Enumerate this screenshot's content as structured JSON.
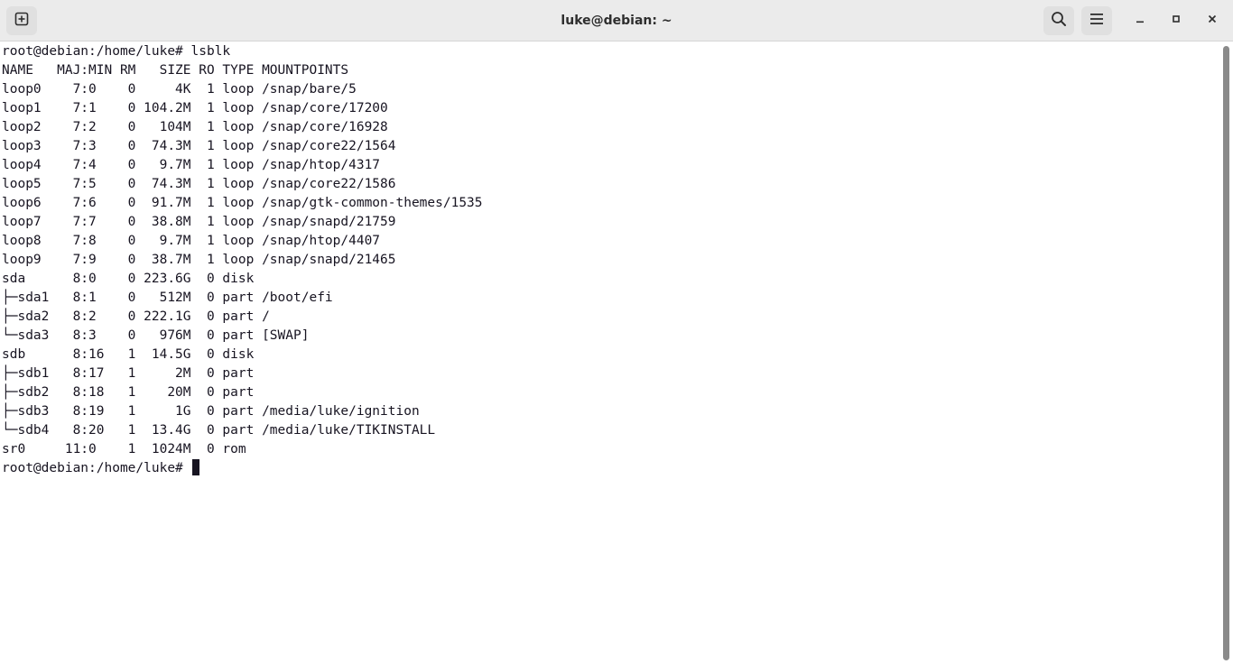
{
  "window": {
    "title": "luke@debian: ~"
  },
  "icons": {
    "new_tab": "new-tab-icon",
    "search": "search-icon",
    "menu": "hamburger-menu-icon",
    "minimize": "minimize-icon",
    "maximize": "maximize-icon",
    "close": "close-icon"
  },
  "terminal": {
    "lines": [
      "root@debian:/home/luke# lsblk",
      "NAME   MAJ:MIN RM   SIZE RO TYPE MOUNTPOINTS",
      "loop0    7:0    0     4K  1 loop /snap/bare/5",
      "loop1    7:1    0 104.2M  1 loop /snap/core/17200",
      "loop2    7:2    0   104M  1 loop /snap/core/16928",
      "loop3    7:3    0  74.3M  1 loop /snap/core22/1564",
      "loop4    7:4    0   9.7M  1 loop /snap/htop/4317",
      "loop5    7:5    0  74.3M  1 loop /snap/core22/1586",
      "loop6    7:6    0  91.7M  1 loop /snap/gtk-common-themes/1535",
      "loop7    7:7    0  38.8M  1 loop /snap/snapd/21759",
      "loop8    7:8    0   9.7M  1 loop /snap/htop/4407",
      "loop9    7:9    0  38.7M  1 loop /snap/snapd/21465",
      "sda      8:0    0 223.6G  0 disk",
      "├─sda1   8:1    0   512M  0 part /boot/efi",
      "├─sda2   8:2    0 222.1G  0 part /",
      "└─sda3   8:3    0   976M  0 part [SWAP]",
      "sdb      8:16   1  14.5G  0 disk",
      "├─sdb1   8:17   1     2M  0 part",
      "├─sdb2   8:18   1    20M  0 part",
      "├─sdb3   8:19   1     1G  0 part /media/luke/ignition",
      "└─sdb4   8:20   1  13.4G  0 part /media/luke/TIKINSTALL",
      "sr0     11:0    1  1024M  0 rom"
    ],
    "prompt": "root@debian:/home/luke# "
  },
  "colors": {
    "headerbar": "#ebebeb",
    "terminal_bg": "#ffffff",
    "terminal_fg": "#171421"
  }
}
